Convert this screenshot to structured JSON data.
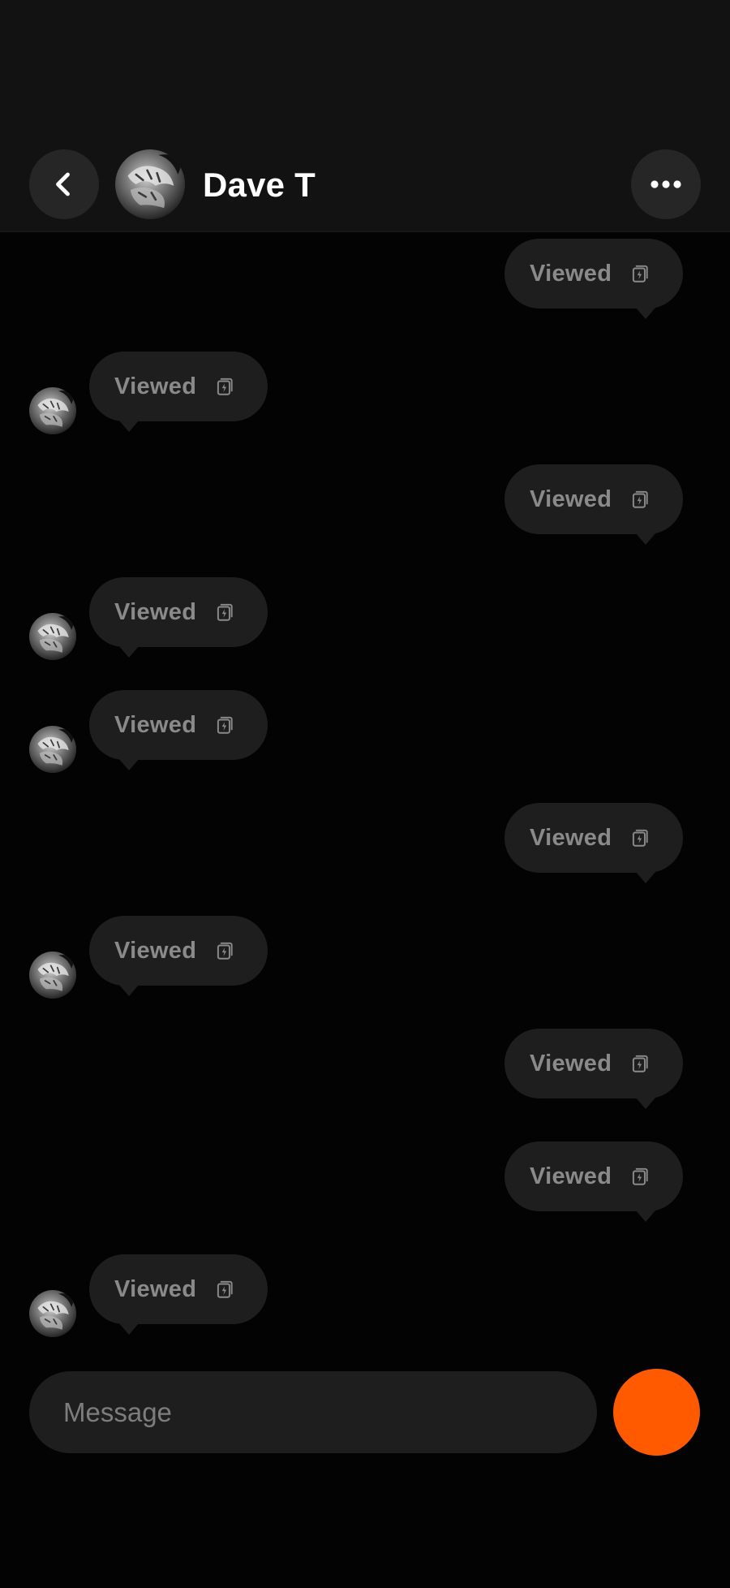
{
  "header": {
    "contact_name": "Dave T",
    "back_icon": "chevron-left-icon",
    "more_icon": "more-horizontal-icon"
  },
  "messages": [
    {
      "side": "sent",
      "label": "Viewed",
      "icon": "snap-viewed-icon"
    },
    {
      "side": "received",
      "label": "Viewed",
      "icon": "snap-viewed-icon"
    },
    {
      "side": "sent",
      "label": "Viewed",
      "icon": "snap-viewed-icon"
    },
    {
      "side": "received",
      "label": "Viewed",
      "icon": "snap-viewed-icon"
    },
    {
      "side": "received",
      "label": "Viewed",
      "icon": "snap-viewed-icon"
    },
    {
      "side": "sent",
      "label": "Viewed",
      "icon": "snap-viewed-icon"
    },
    {
      "side": "received",
      "label": "Viewed",
      "icon": "snap-viewed-icon"
    },
    {
      "side": "sent",
      "label": "Viewed",
      "icon": "snap-viewed-icon"
    },
    {
      "side": "sent",
      "label": "Viewed",
      "icon": "snap-viewed-icon"
    },
    {
      "side": "received",
      "label": "Viewed",
      "icon": "snap-viewed-icon"
    }
  ],
  "composer": {
    "placeholder": "Message",
    "send_color": "#FF5A00"
  },
  "colors": {
    "background": "#030303",
    "header": "#121212",
    "bubble": "#1E1E1E",
    "bubble_text": "#8A8A8A",
    "accent": "#FF5A00"
  }
}
